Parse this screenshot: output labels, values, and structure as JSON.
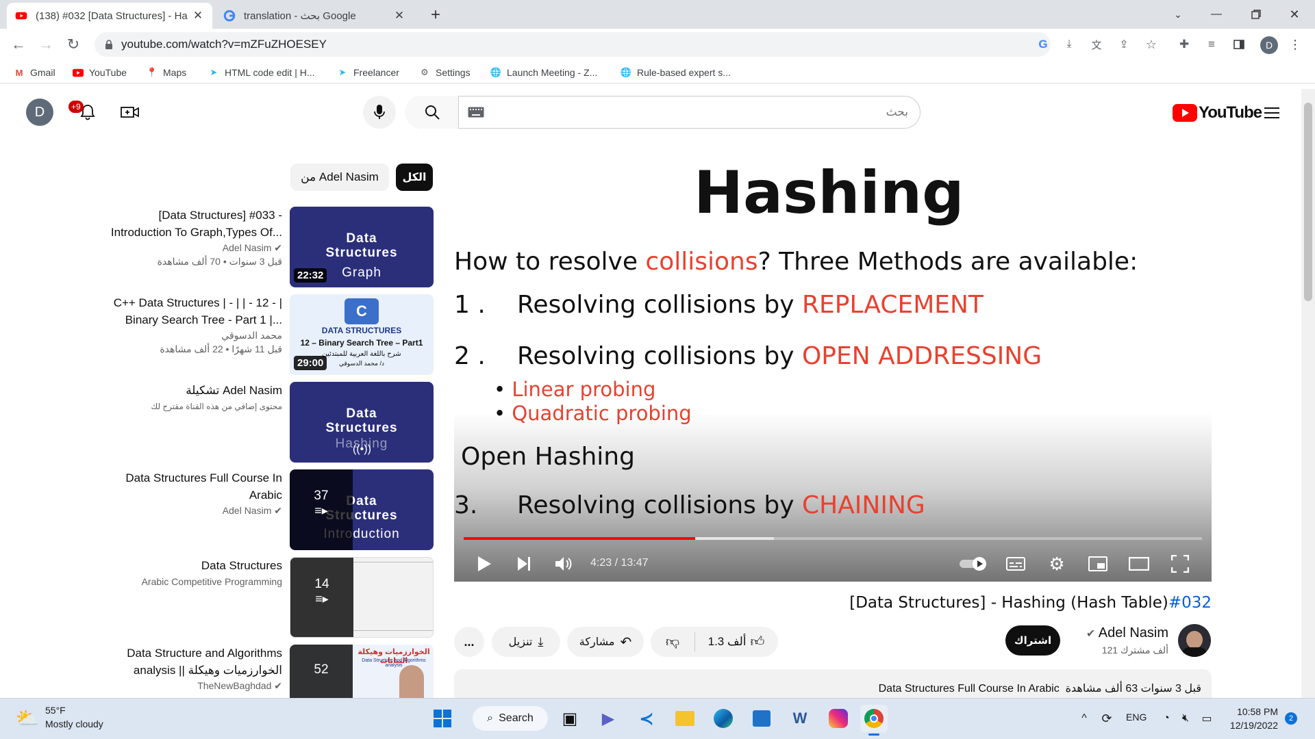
{
  "browser": {
    "tabs": [
      {
        "title": "(138) #032 [Data Structures] - Ha",
        "active": true
      },
      {
        "title": "translation - بحث Google",
        "active": false
      }
    ],
    "url": "youtube.com/watch?v=mZFuZHOESEY",
    "profile_initial": "D",
    "bookmarks": [
      "Gmail",
      "YouTube",
      "Maps",
      "HTML code edit | H...",
      "Freelancer",
      "Settings",
      "Launch Meeting - Z...",
      "Rule-based expert s..."
    ]
  },
  "youtube": {
    "avatar_initial": "D",
    "notification_count": "+9",
    "search_placeholder": "بحث",
    "logo_text": "YouTube",
    "chips": {
      "all": "الكل",
      "from_channel": "من Adel Nasim"
    }
  },
  "sidebar": {
    "items": [
      {
        "title": "[Data Structures] #033 - Introduction To Graph,Types Of...",
        "channel": "Adel Nasim",
        "verified": true,
        "views": "70 ألف مشاهدة",
        "age": "قبل 3 سنوات",
        "duration": "22:32",
        "thumb_lines": [
          "Data",
          "Structures",
          "Graph"
        ]
      },
      {
        "title": "C++ Data Structures | - | | - 12 - | Binary Search Tree - Part 1 |...",
        "channel": "محمد الدسوقي",
        "verified": false,
        "views": "22 ألف مشاهدة",
        "age": "قبل 11 شهرًا",
        "duration": "29:00",
        "thumb_lines": [
          "DATA STRUCTURES",
          "12 – Binary Search Tree – Part1",
          "شرح باللغة العربية للمبتدئين",
          "د/ محمد الدسوقي"
        ]
      },
      {
        "title": "تشكيلة Adel Nasim",
        "channel": "محتوى إضافي من هذه القناة مقترح لك",
        "verified": false,
        "thumb_lines": [
          "Data",
          "Structures",
          "Hashing"
        ]
      },
      {
        "title": "Data Structures Full Course In Arabic",
        "channel": "Adel Nasim",
        "verified": true,
        "count": "37",
        "thumb_lines": [
          "Data",
          "Structures",
          "Introduction"
        ]
      },
      {
        "title": "Data Structures",
        "channel": "Arabic Competitive Programming",
        "verified": false,
        "count": "14"
      },
      {
        "title": "Data Structure and Algorithms analysis || الخوارزميات وهيكلة البيانات",
        "channel": "TheNewBaghdad",
        "verified": true,
        "count": "52",
        "thumb_lines": [
          "الخوارزميات وهيكلة البيانات",
          "Data Structure and Algorithms analysis"
        ]
      }
    ]
  },
  "slide": {
    "title": "Hashing",
    "question_pre": "How to resolve ",
    "question_red": "collisions",
    "question_post": "? Three Methods are available:",
    "m1_num": "1 .",
    "m1_text": "Resolving collisions by ",
    "m1_red": "REPLACEMENT",
    "m2_num": "2 .",
    "m2_text": "Resolving collisions by ",
    "m2_red": "OPEN ADDRESSING",
    "bullet1": "Linear probing",
    "bullet2": "Quadratic probing",
    "open_hashing": "Open Hashing",
    "m3_num": "3.",
    "m3_text": "Resolving collisions by ",
    "m3_red": "CHAINING"
  },
  "player": {
    "time": "4:23 / 13:47",
    "progress_played": 0.314,
    "progress_buffered": 0.42
  },
  "video": {
    "title_main": "[Data Structures] - Hashing (Hash Table)",
    "title_tag": "#032",
    "channel": "Adel Nasim",
    "subscribers": "121 ألف مشترك",
    "subscribe_label": "اشتراك",
    "likes": "1.3 ألف",
    "share_label": "مشاركة",
    "download_label": "تنزيل",
    "more_label": "...",
    "desc_views": "63 ألف مشاهدة",
    "desc_age": "قبل 3 سنوات",
    "desc_playlist": "Data Structures Full Course In Arabic"
  },
  "taskbar": {
    "weather_temp": "55°F",
    "weather_desc": "Mostly cloudy",
    "search_label": "Search",
    "lang": "ENG",
    "time": "10:58 PM",
    "date": "12/19/2022",
    "notif_count": "2"
  },
  "colors": {
    "youtube_red": "#ff0000",
    "accent_red": "#e8412f",
    "link_blue": "#065fd4",
    "tab_bg": "#dee1e6"
  }
}
